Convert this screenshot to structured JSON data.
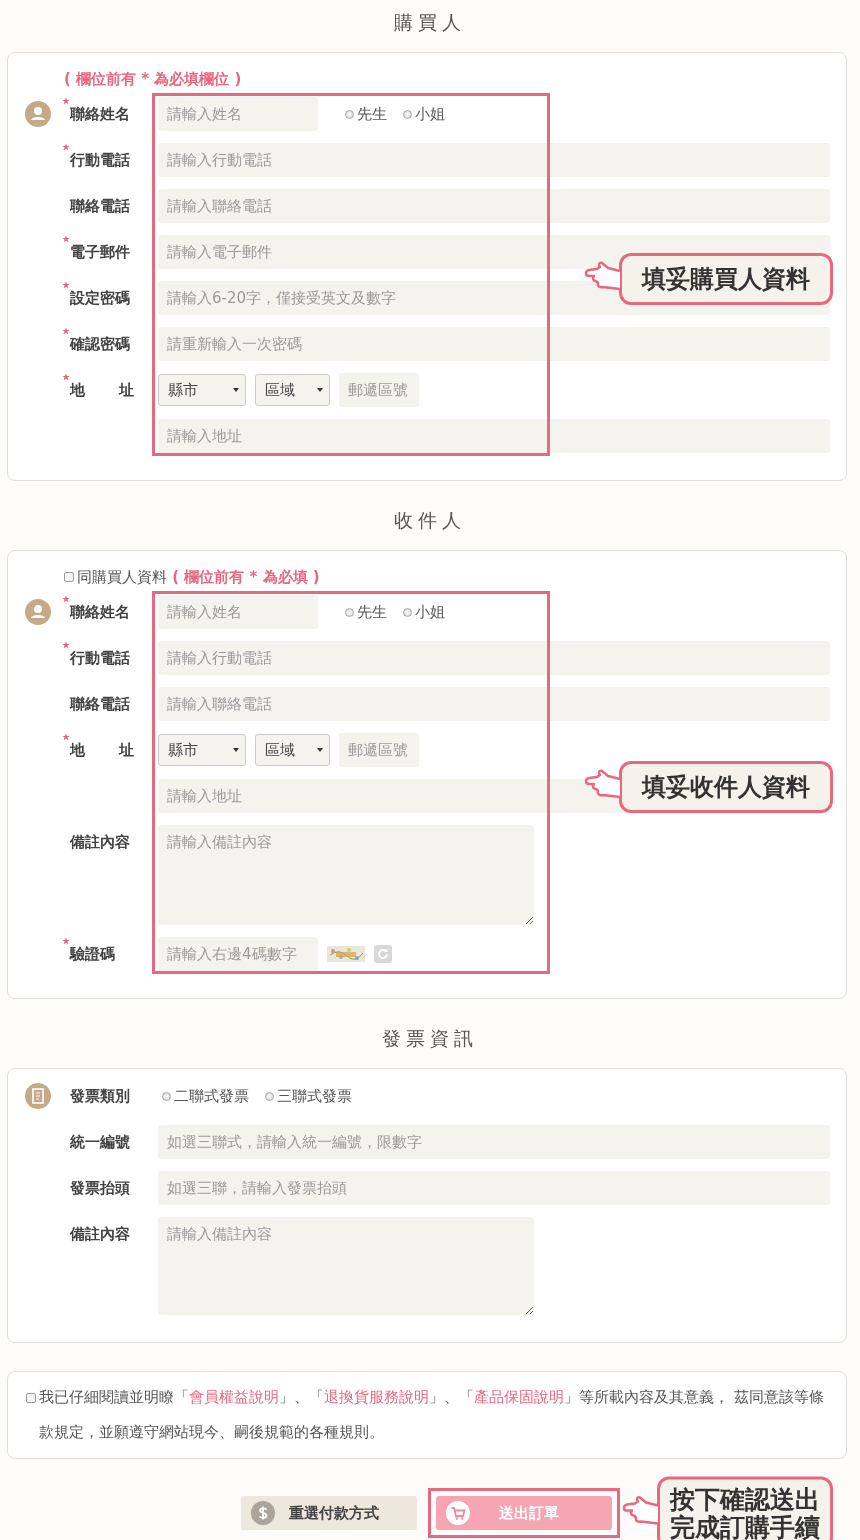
{
  "sections": [
    {
      "kind": "buyer",
      "title": "購買人",
      "note": "( 欄位前有 * 為必填欄位 )",
      "rows": [
        {
          "kind": "name",
          "label": "聯絡姓名",
          "required": true,
          "placeholder": "請輸入姓名",
          "options": [
            {
              "label": "先生",
              "selected": false
            },
            {
              "label": "小姐",
              "selected": false
            }
          ]
        },
        {
          "kind": "text",
          "label": "行動電話",
          "required": true,
          "placeholder": "請輸入行動電話"
        },
        {
          "kind": "text",
          "label": "聯絡電話",
          "required": false,
          "placeholder": "請輸入聯絡電話"
        },
        {
          "kind": "text",
          "label": "電子郵件",
          "required": true,
          "placeholder": "請輸入電子郵件"
        },
        {
          "kind": "text",
          "label": "設定密碼",
          "required": true,
          "placeholder": "請輸入6-20字，僅接受英文及數字"
        },
        {
          "kind": "text",
          "label": "確認密碼",
          "required": true,
          "placeholder": "請重新輸入一次密碼"
        },
        {
          "kind": "address",
          "label": "地址",
          "required": true,
          "city": "縣市",
          "district": "區域",
          "zip_placeholder": "郵遞區號",
          "placeholder": "請輸入地址"
        }
      ],
      "callout": [
        "填妥購買人資料"
      ]
    },
    {
      "kind": "recipient",
      "title": "收件人",
      "same_as_buyer": {
        "label": "同購買人資料",
        "checked": false
      },
      "note": "( 欄位前有 * 為必填 )",
      "rows": [
        {
          "kind": "name",
          "label": "聯絡姓名",
          "required": true,
          "placeholder": "請輸入姓名",
          "options": [
            {
              "label": "先生",
              "selected": false
            },
            {
              "label": "小姐",
              "selected": false
            }
          ]
        },
        {
          "kind": "text",
          "label": "行動電話",
          "required": true,
          "placeholder": "請輸入行動電話"
        },
        {
          "kind": "text",
          "label": "聯絡電話",
          "required": false,
          "placeholder": "請輸入聯絡電話"
        },
        {
          "kind": "address",
          "label": "地址",
          "required": true,
          "city": "縣市",
          "district": "區域",
          "zip_placeholder": "郵遞區號",
          "placeholder": "請輸入地址"
        },
        {
          "kind": "textarea",
          "label": "備註內容",
          "required": false,
          "placeholder": "請輸入備註內容"
        },
        {
          "kind": "captcha",
          "label": "驗證碼",
          "required": true,
          "placeholder": "請輸入右邊4碼數字"
        }
      ],
      "callout": [
        "填妥收件人資料"
      ]
    },
    {
      "kind": "invoice",
      "title": "發票資訊",
      "rows": [
        {
          "kind": "radio",
          "label": "發票類別",
          "required": false,
          "options": [
            {
              "label": "二聯式發票",
              "selected": false
            },
            {
              "label": "三聯式發票",
              "selected": false
            }
          ]
        },
        {
          "kind": "text",
          "label": "統一編號",
          "required": false,
          "placeholder": "如選三聯式，請輸入統一編號，限數字"
        },
        {
          "kind": "text",
          "label": "發票抬頭",
          "required": false,
          "placeholder": "如選三聯，請輸入發票抬頭"
        },
        {
          "kind": "textarea",
          "label": "備註內容",
          "required": false,
          "placeholder": "請輸入備註內容"
        }
      ]
    }
  ],
  "agreement": {
    "checked": false,
    "parts": [
      {
        "kind": "text",
        "text": "我已仔細閱讀並明瞭「"
      },
      {
        "kind": "link",
        "text": "會員權益說明"
      },
      {
        "kind": "text",
        "text": "」、「"
      },
      {
        "kind": "link",
        "text": "退換貨服務說明"
      },
      {
        "kind": "text",
        "text": "」、「"
      },
      {
        "kind": "link",
        "text": "產品保固說明"
      },
      {
        "kind": "text",
        "text": "」等所載內容及其意義， 茲同意該等條款規定，並願遵守網站現今、嗣後規範的各種規則。"
      }
    ]
  },
  "buttons": [
    {
      "kind": "reset",
      "label": "重選付款方式"
    },
    {
      "kind": "submit",
      "label": "送出訂單"
    }
  ],
  "submit_callout": [
    "按下確認送出",
    "完成訂購手續"
  ]
}
